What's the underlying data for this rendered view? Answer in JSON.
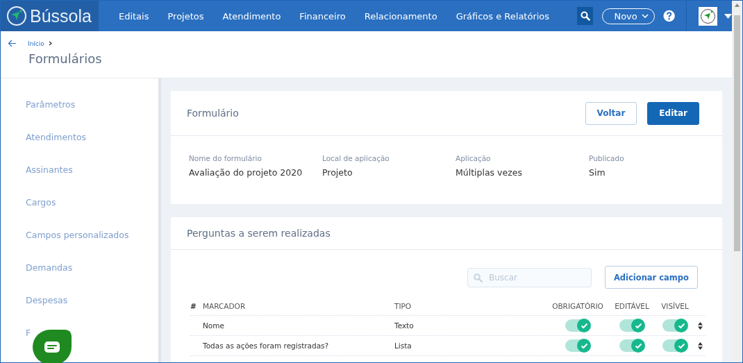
{
  "app": {
    "name": "Bússola"
  },
  "nav": {
    "items": [
      "Editais",
      "Projetos",
      "Atendimento",
      "Financeiro",
      "Relacionamento",
      "Gráficos e Relatórios"
    ],
    "new_button": "Novo"
  },
  "breadcrumb": {
    "items": [
      "Início"
    ],
    "title": "Formulários"
  },
  "sidebar": {
    "items": [
      {
        "label": "Parâmetros"
      },
      {
        "label": "Atendimentos"
      },
      {
        "label": "Assinantes"
      },
      {
        "label": "Cargos"
      },
      {
        "label": "Campos personalizados"
      },
      {
        "label": "Demandas"
      },
      {
        "label": "Despesas"
      },
      {
        "label": "F"
      }
    ]
  },
  "form_card": {
    "title": "Formulário",
    "buttons": [
      {
        "label": "Voltar",
        "kind": "secondary"
      },
      {
        "label": "Editar",
        "kind": "primary"
      }
    ],
    "fields": [
      {
        "label": "Nome do formulário",
        "value": "Avaliação do projeto 2020"
      },
      {
        "label": "Local de aplicação",
        "value": "Projeto"
      },
      {
        "label": "Aplicação",
        "value": "Múltiplas vezes"
      },
      {
        "label": "Publicado",
        "value": "Sim"
      }
    ]
  },
  "questions_card": {
    "title": "Perguntas a serem realizadas",
    "search": {
      "placeholder": "Buscar"
    },
    "add_button": "Adicionar campo",
    "table": {
      "columns": [
        "#",
        "MARCADOR",
        "TIPO",
        "OBRIGATÓRIO",
        "EDITÁVEL",
        "VISÍVEL"
      ],
      "rows": [
        {
          "marcador": "Nome",
          "tipo": "Texto",
          "obrigatorio": true,
          "editavel": true,
          "visivel": true
        },
        {
          "marcador": "Todas as ações foram registradas?",
          "tipo": "Lista",
          "obrigatorio": true,
          "editavel": true,
          "visivel": true
        }
      ]
    }
  }
}
